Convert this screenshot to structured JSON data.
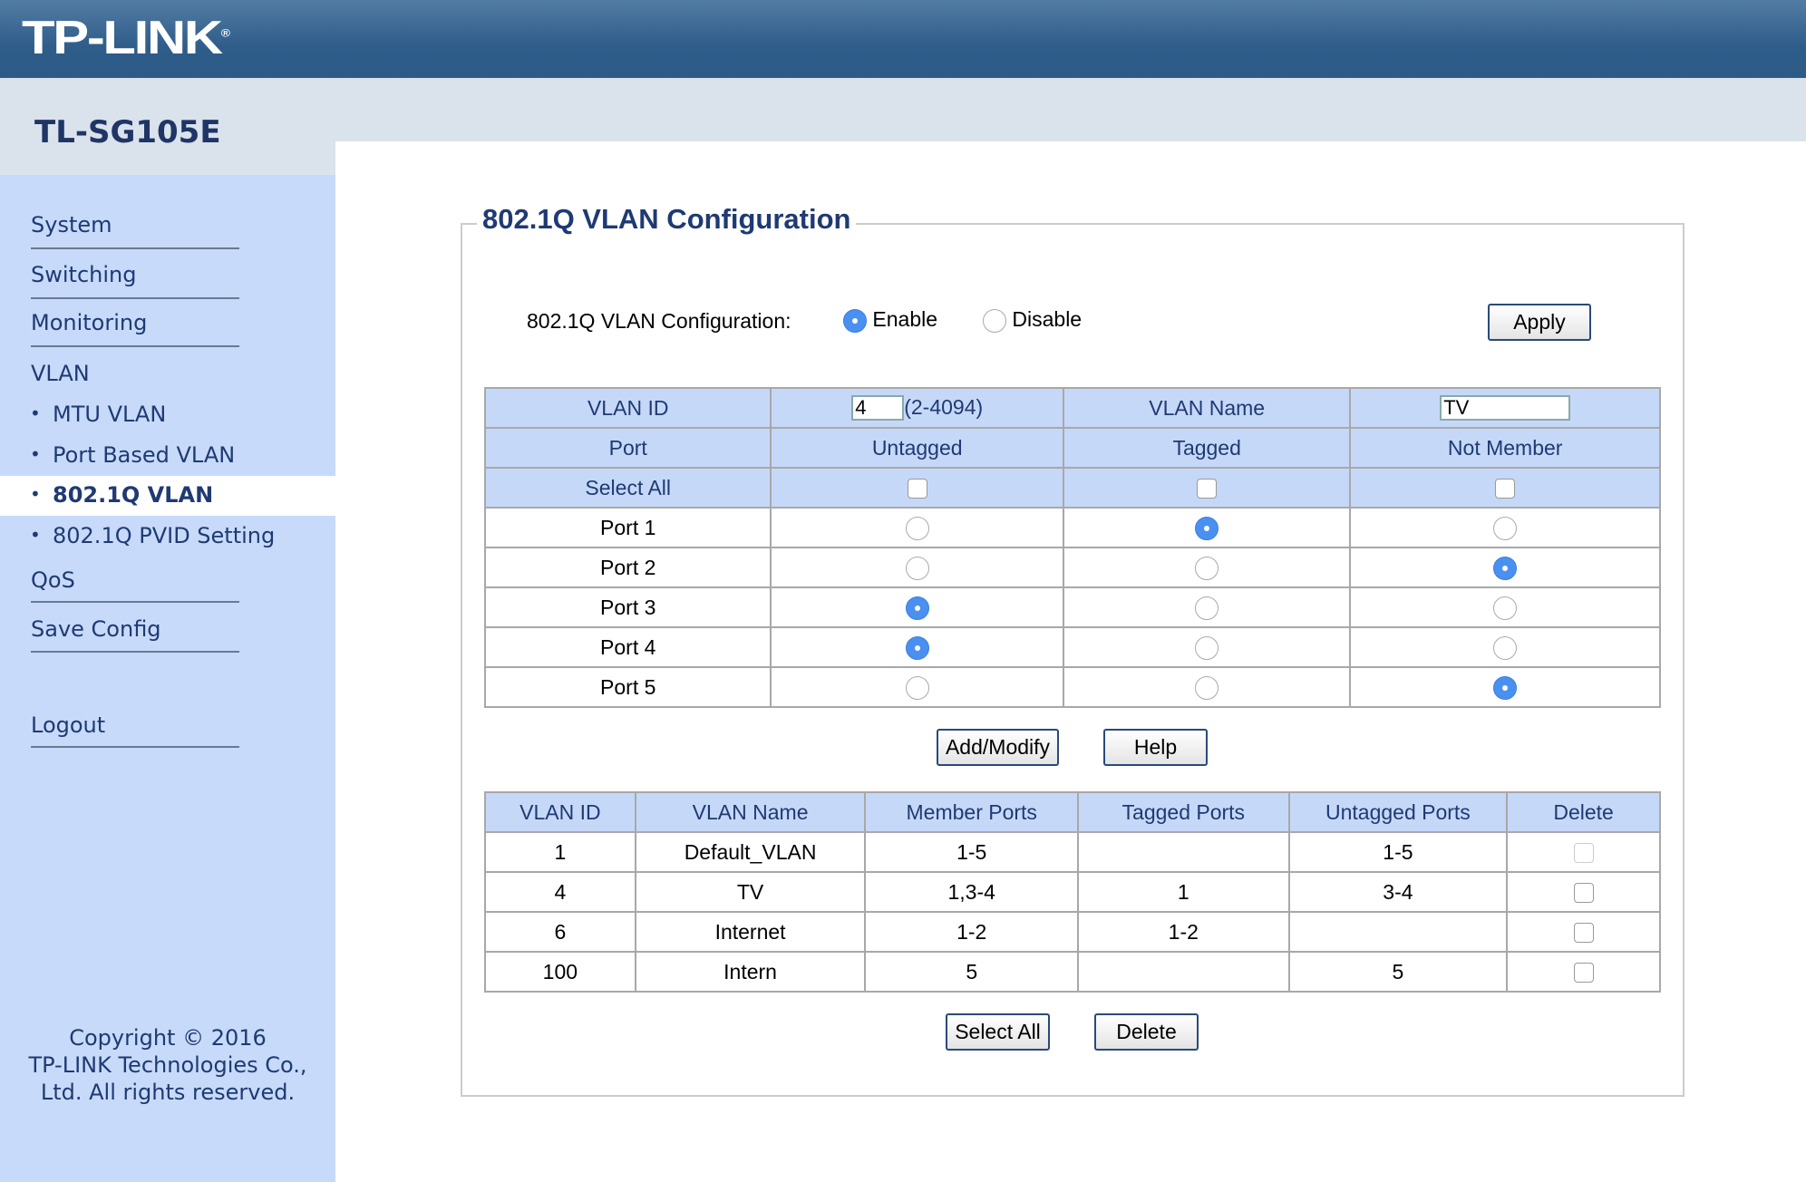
{
  "brand": {
    "logo": "TP-LINK",
    "model": "TL-SG105E"
  },
  "sidebar": {
    "items": [
      {
        "label": "System"
      },
      {
        "label": "Switching"
      },
      {
        "label": "Monitoring"
      },
      {
        "label": "VLAN"
      },
      {
        "label": "MTU VLAN"
      },
      {
        "label": "Port Based VLAN"
      },
      {
        "label": "802.1Q VLAN",
        "active": true
      },
      {
        "label": "802.1Q PVID Setting"
      },
      {
        "label": "QoS"
      },
      {
        "label": "Save Config"
      },
      {
        "label": "Logout"
      }
    ],
    "copyright": [
      "Copyright © 2016",
      "TP-LINK Technologies Co.,",
      "Ltd. All rights reserved."
    ]
  },
  "main": {
    "title": "802.1Q VLAN Configuration",
    "config_label": "802.1Q VLAN Configuration:",
    "enable_label": "Enable",
    "disable_label": "Disable",
    "selected": "Enable",
    "apply_label": "Apply",
    "form": {
      "vlan_id_label": "VLAN ID",
      "vlan_id_value": "4",
      "vlan_id_range": "(2-4094)",
      "vlan_name_label": "VLAN Name",
      "vlan_name_value": "TV",
      "headers": [
        "Port",
        "Untagged",
        "Tagged",
        "Not Member"
      ],
      "select_all_label": "Select All",
      "ports": [
        {
          "name": "Port 1",
          "mode": "Tagged"
        },
        {
          "name": "Port 2",
          "mode": "Not Member"
        },
        {
          "name": "Port 3",
          "mode": "Untagged"
        },
        {
          "name": "Port 4",
          "mode": "Untagged"
        },
        {
          "name": "Port 5",
          "mode": "Not Member"
        }
      ]
    },
    "add_modify_label": "Add/Modify",
    "help_label": "Help",
    "vlan_table": {
      "headers": [
        "VLAN ID",
        "VLAN Name",
        "Member Ports",
        "Tagged Ports",
        "Untagged Ports",
        "Delete"
      ],
      "rows": [
        [
          "1",
          "Default_VLAN",
          "1-5",
          "",
          "1-5"
        ],
        [
          "4",
          "TV",
          "1,3-4",
          "1",
          "3-4"
        ],
        [
          "6",
          "Internet",
          "1-2",
          "1-2",
          ""
        ],
        [
          "100",
          "Intern",
          "5",
          "",
          "5"
        ]
      ]
    },
    "select_all_btn": "Select All",
    "delete_btn": "Delete"
  }
}
